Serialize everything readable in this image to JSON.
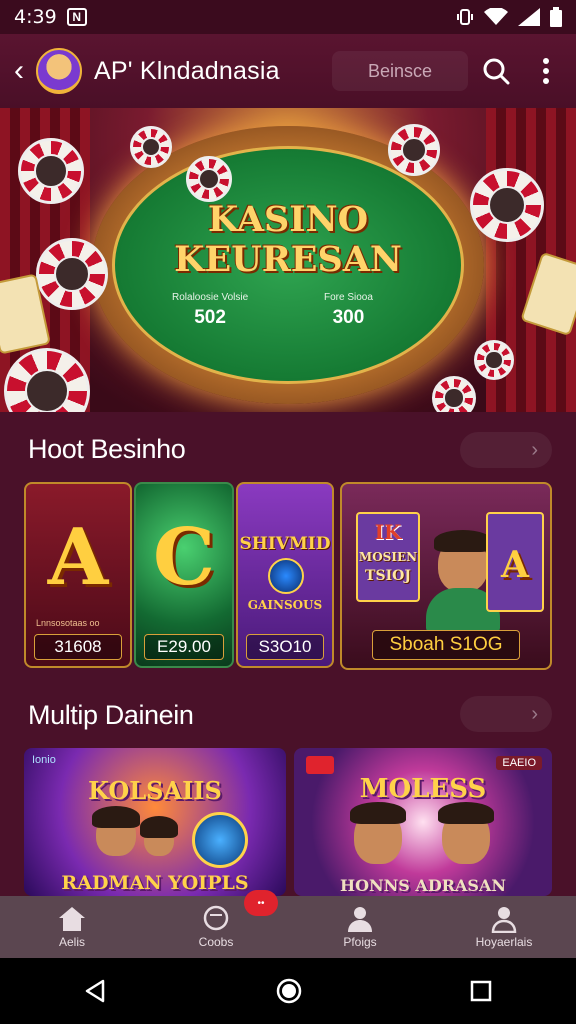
{
  "status": {
    "time": "4:39",
    "notif": "N"
  },
  "appbar": {
    "title": "AP' Klndadnasia",
    "search_placeholder": "Beinsce"
  },
  "hero": {
    "title_line1": "KASINO",
    "title_line2": "KEURESAN",
    "stat_left_label": "Rolaloosie Volsie",
    "stat_left_value": "502",
    "stat_right_label": "Fore Siooa",
    "stat_right_value": "300"
  },
  "section1": {
    "title": "Hoot Besinho",
    "games": [
      {
        "glyph": "A",
        "caption": "Lnnsosotaas oo",
        "value": "31608"
      },
      {
        "glyph": "C",
        "value": "E29.00"
      },
      {
        "glyph": "SHIVMID",
        "sub": "GAINSOUS",
        "value": "S3O10"
      },
      {
        "top": "IK",
        "line1": "MOSIEN",
        "line2": "TSIOJ",
        "glyph": "A",
        "value": "Sboah S1OG"
      }
    ]
  },
  "section2": {
    "title": "Multip Dainein",
    "promos": [
      {
        "tag": "Ionio",
        "title": "KOLSAIIS",
        "bottom": "RADMAN YOIPLS"
      },
      {
        "tag": "EAEIO",
        "title": "MOLESS",
        "bottom": "HONNS ADRASAN"
      }
    ]
  },
  "tabs": [
    {
      "label": "Aelis",
      "icon": "home-icon"
    },
    {
      "label": "Coobs",
      "icon": "chat-icon",
      "badge": "••"
    },
    {
      "label": "Pfoigs",
      "icon": "people-icon"
    },
    {
      "label": "Hoyaerlais",
      "icon": "profile-icon"
    }
  ],
  "colors": {
    "background": "#3a0d1f",
    "panel": "#4a1129",
    "accent_gold": "#ffcf40",
    "tabbar": "#5b4650"
  }
}
